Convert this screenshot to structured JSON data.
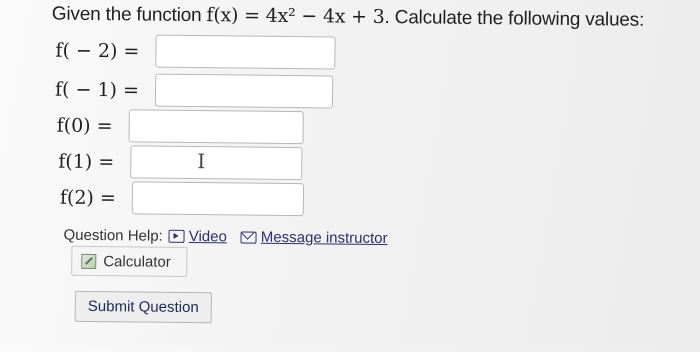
{
  "question": {
    "prefix": "Given the function ",
    "function_math": "f(x) = 4x² − 4x + 3",
    "suffix": ". Calculate the following values:"
  },
  "inputs": [
    {
      "label": "f( − 2) =",
      "value": ""
    },
    {
      "label": "f( − 1) =",
      "value": ""
    },
    {
      "label": "f(0) =",
      "value": ""
    },
    {
      "label": "f(1) =",
      "value": ""
    },
    {
      "label": "f(2) =",
      "value": ""
    }
  ],
  "help": {
    "label": "Question Help:",
    "video_label": "Video",
    "message_label": "Message instructor",
    "calculator_label": "Calculator"
  },
  "submit_label": "Submit Question",
  "icons": {
    "video": "video-icon",
    "message": "mail-icon",
    "calculator": "calculator-icon",
    "text_cursor": "text-cursor-icon"
  }
}
